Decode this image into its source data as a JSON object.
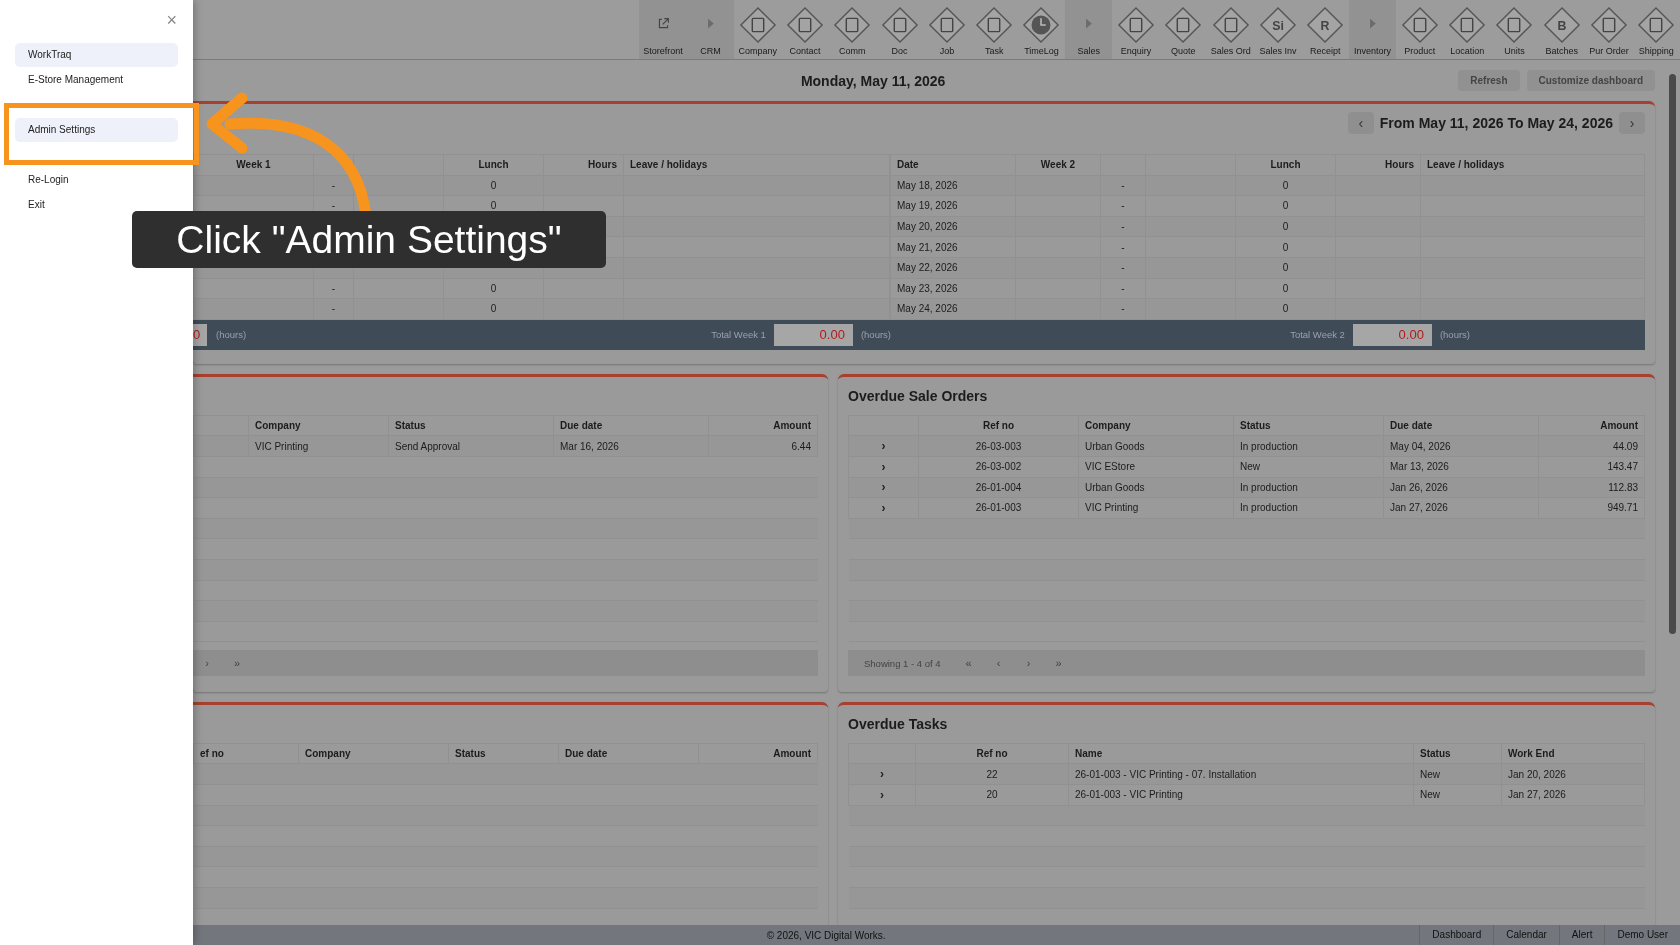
{
  "sidebar": {
    "close": "×",
    "items": [
      {
        "label": "WorkTraq",
        "selected": true,
        "kind": "item"
      },
      {
        "label": "E-Store Management",
        "selected": false,
        "kind": "item"
      },
      {
        "label": "Admin Settings",
        "selected": true,
        "kind": "focus"
      },
      {
        "label": "Re-Login",
        "selected": false,
        "kind": "item"
      },
      {
        "label": "Exit",
        "selected": false,
        "kind": "item"
      }
    ]
  },
  "toolbar": [
    {
      "label": "Storefront",
      "kind": "link"
    },
    {
      "label": "CRM",
      "kind": "section"
    },
    {
      "label": "Company",
      "kind": "module"
    },
    {
      "label": "Contact",
      "kind": "module"
    },
    {
      "label": "Comm",
      "kind": "module"
    },
    {
      "label": "Doc",
      "kind": "module"
    },
    {
      "label": "Job",
      "kind": "module"
    },
    {
      "label": "Task",
      "kind": "module"
    },
    {
      "label": "TimeLog",
      "kind": "clock"
    },
    {
      "label": "Sales",
      "kind": "section"
    },
    {
      "label": "Enquiry",
      "kind": "module"
    },
    {
      "label": "Quote",
      "kind": "module"
    },
    {
      "label": "Sales Ord",
      "kind": "module"
    },
    {
      "label": "Sales Inv",
      "kind": "module",
      "glyph": "Si"
    },
    {
      "label": "Receipt",
      "kind": "module",
      "glyph": "R"
    },
    {
      "label": "Inventory",
      "kind": "section"
    },
    {
      "label": "Product",
      "kind": "module"
    },
    {
      "label": "Location",
      "kind": "module"
    },
    {
      "label": "Units",
      "kind": "module"
    },
    {
      "label": "Batches",
      "kind": "module",
      "glyph": "B"
    },
    {
      "label": "Pur Order",
      "kind": "module"
    },
    {
      "label": "Shipping",
      "kind": "module"
    }
  ],
  "date": "Monday, May 11, 2026",
  "actions": [
    "Refresh",
    "Customize dashboard"
  ],
  "timesheet": {
    "range_prev": "‹",
    "range": "From May 11, 2026 To May 24, 2026",
    "range_next": "›",
    "week1": {
      "columns": [
        "Week 1",
        "Lunch",
        "Hours",
        "Leave / holidays"
      ],
      "rows": [
        {
          "dash": "-",
          "lunch": "0"
        },
        {
          "dash": "-",
          "lunch": "0"
        },
        {},
        {},
        {},
        {
          "dash": "-",
          "lunch": "0"
        },
        {
          "dash": "-",
          "lunch": "0"
        }
      ]
    },
    "week2": {
      "columns": [
        "Date",
        "Week 2",
        "Lunch",
        "Hours",
        "Leave / holidays"
      ],
      "rows": [
        {
          "date": "May 18, 2026",
          "dash": "-",
          "lunch": "0"
        },
        {
          "date": "May 19, 2026",
          "dash": "-",
          "lunch": "0"
        },
        {
          "date": "May 20, 2026",
          "dash": "-",
          "lunch": "0"
        },
        {
          "date": "May 21, 2026",
          "dash": "-",
          "lunch": "0"
        },
        {
          "date": "May 22, 2026",
          "dash": "-",
          "lunch": "0"
        },
        {
          "date": "May 23, 2026",
          "dash": "-",
          "lunch": "0"
        },
        {
          "date": "May 24, 2026",
          "dash": "-",
          "lunch": "0"
        }
      ]
    },
    "totals": {
      "partial_value": "0",
      "partial_unit": "(hours)",
      "weeks": [
        {
          "label": "Total Week 1",
          "value": "0.00",
          "unit": "(hours)"
        },
        {
          "label": "Total Week 2",
          "value": "0.00",
          "unit": "(hours)"
        }
      ]
    }
  },
  "left_orders": {
    "columns": [
      "Company",
      "Status",
      "Due date",
      "Amount"
    ],
    "rows": [
      [
        "VIC Printing",
        "Send Approval",
        "Mar 16, 2026",
        "6.44"
      ]
    ],
    "pager": [
      "›",
      "»"
    ]
  },
  "overdue_sale_orders": {
    "title": "Overdue Sale Orders",
    "columns": [
      "Ref no",
      "Company",
      "Status",
      "Due date",
      "Amount"
    ],
    "rows": [
      [
        "26-03-003",
        "Urban Goods",
        "In production",
        "May 04, 2026",
        "44.09"
      ],
      [
        "26-03-002",
        "VIC EStore",
        "New",
        "Mar 13, 2026",
        "143.47"
      ],
      [
        "26-01-004",
        "Urban Goods",
        "In production",
        "Jan 26, 2026",
        "112.83"
      ],
      [
        "26-01-003",
        "VIC Printing",
        "In production",
        "Jan 27, 2026",
        "949.71"
      ]
    ],
    "expander": "›",
    "showing": "Showing 1 - 4 of 4",
    "pager": [
      "«",
      "‹",
      "›",
      "»"
    ]
  },
  "left_bottom": {
    "columns": [
      "ef no",
      "Company",
      "Status",
      "Due date",
      "Amount"
    ]
  },
  "overdue_tasks": {
    "title": "Overdue Tasks",
    "columns": [
      "Ref no",
      "Name",
      "Status",
      "Work End"
    ],
    "rows": [
      [
        "22",
        "26-01-003 - VIC Printing - 07. Installation",
        "New",
        "Jan 20, 2026"
      ],
      [
        "20",
        "26-01-003 - VIC Printing",
        "New",
        "Jan 27, 2026"
      ]
    ],
    "expander": "›"
  },
  "footer": {
    "copyright": "© 2026, VIC Digital Works.",
    "links": [
      "Dashboard",
      "Calendar",
      "Alert",
      "Demo User"
    ]
  },
  "tooltip": "Click \"Admin Settings\""
}
